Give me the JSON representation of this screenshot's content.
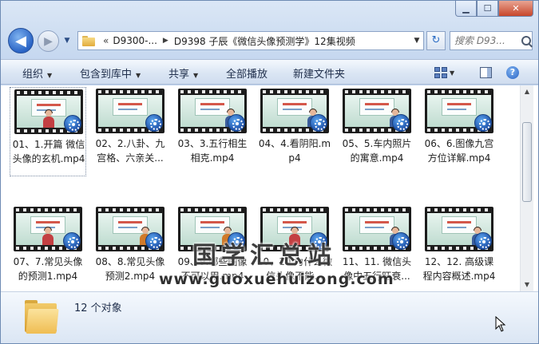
{
  "window": {
    "caption_min": "▁",
    "caption_max": "☐",
    "caption_close": "✕"
  },
  "nav": {
    "back_glyph": "◀",
    "forward_glyph": "▶",
    "history_glyph": "▼",
    "breadcrumb_overflow": "«",
    "breadcrumb": [
      "D9300-...",
      "D9398 子辰《微信头像预测学》12集视频"
    ],
    "crumb_sep": "▶",
    "address_dropdown_glyph": "▼",
    "refresh_glyph": "↻",
    "search_placeholder": "搜索 D93..."
  },
  "commands": {
    "organize": "组织",
    "include_library": "包含到库中",
    "share": "共享",
    "play_all": "全部播放",
    "new_folder": "新建文件夹",
    "dropdown_glyph": "▼",
    "help_glyph": "?"
  },
  "files": [
    {
      "name": "01、1.开篇 微信头像的玄机.mp4",
      "scene": "presenter-center"
    },
    {
      "name": "02、2.八卦、九宫格、六亲关...",
      "scene": "slide"
    },
    {
      "name": "03、3.五行相生相克.mp4",
      "scene": "presenter-right"
    },
    {
      "name": "04、4.看阴阳.mp4",
      "scene": "presenter-right"
    },
    {
      "name": "05、5.车内照片的寓意.mp4",
      "scene": "presenter-right"
    },
    {
      "name": "06、6.图像九宫方位详解.mp4",
      "scene": "slide"
    },
    {
      "name": "07、7.常见头像的预测1.mp4",
      "scene": "presenter-center"
    },
    {
      "name": "08、8.常见头像预测2.mp4",
      "scene": "presenter-left"
    },
    {
      "name": "09、9.哪些图像不可以用.mp4",
      "scene": "presenter-left"
    },
    {
      "name": "10、10.为什么微信头像不能...",
      "scene": "presenter-center"
    },
    {
      "name": "11、11. 微信头像中五行旺衰...",
      "scene": "presenter-right"
    },
    {
      "name": "12、12. 高级课程内容概述.mp4",
      "scene": "presenter-right"
    }
  ],
  "watermark": {
    "cn": "国学汇总站",
    "url": "www.guoxuehuizong.com"
  },
  "details": {
    "count": "12 个对象"
  },
  "scrollbar": {
    "up_glyph": "▲",
    "down_glyph": "▼"
  },
  "colors": {
    "accent": "#2a64c5",
    "chrome": "#c9daf0",
    "selection_border": "#7b8ba3"
  }
}
